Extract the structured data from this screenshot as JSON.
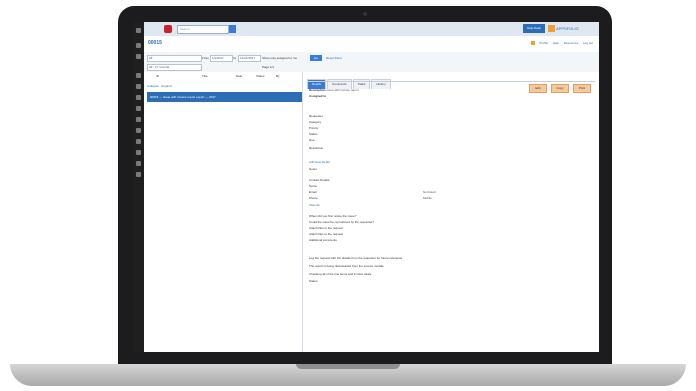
{
  "topbar": {
    "search_placeholder": "Search",
    "button_label": "Help Desk",
    "brand": "APPSFOLIO"
  },
  "title": {
    "page_title": "00015",
    "links": [
      "Profile",
      "Help",
      "Resources",
      "Log out"
    ]
  },
  "filters": {
    "field1": "All",
    "label_from": "From",
    "from_value": "1/1/2017",
    "label_to": "To",
    "to_value": "12/31/2017",
    "checkbox_label": "Show only assigned to me",
    "apply_label": "Go",
    "reset_label": "Reset filters",
    "field2": "All - 17 records",
    "page_label": "Page 1/1"
  },
  "left": {
    "columns": [
      "ID",
      "Title",
      "Date",
      "Status",
      "By"
    ],
    "links": [
      "Collapse",
      "Expand"
    ],
    "selected_row": "00015 — Issue with invoice report export — 2017"
  },
  "right": {
    "tabs": [
      "Details",
      "Comments",
      "Tasks",
      "History"
    ],
    "buttons": [
      "Edit",
      "Copy",
      "Print"
    ],
    "fields": [
      {
        "label": "Description",
        "value": "Issue with invoice report"
      },
      {
        "label": "Assigned to",
        "value": ""
      },
      {
        "label": "Requester",
        "value": ""
      },
      {
        "label": "Category",
        "value": ""
      },
      {
        "label": "Priority",
        "value": ""
      },
      {
        "label": "Status",
        "value": ""
      },
      {
        "label": "Due",
        "value": ""
      },
      {
        "label": "Resolution",
        "value": ""
      }
    ],
    "section_link": "Add New Detail",
    "notes_label": "Notes",
    "contact_label": "Contact Details",
    "contact_fields": [
      {
        "label": "Name",
        "value": ""
      },
      {
        "label": "Email",
        "value": "",
        "extra": "Not listed"
      },
      {
        "label": "Phone",
        "value": "",
        "extra": "Mobile"
      }
    ],
    "link2": "View All",
    "questions": [
      "When did you first notice the issue?",
      "Could the issue be reproduced by the requester?",
      "Attach files to the request",
      "Attach files to the request",
      "Additional comments"
    ],
    "footer_lines": [
      "Log the request with the details from the requester for future reference",
      "The report is being downloaded from the invoice module",
      "Checking all of the line items and invoice totals"
    ],
    "footer_small": "Status"
  }
}
